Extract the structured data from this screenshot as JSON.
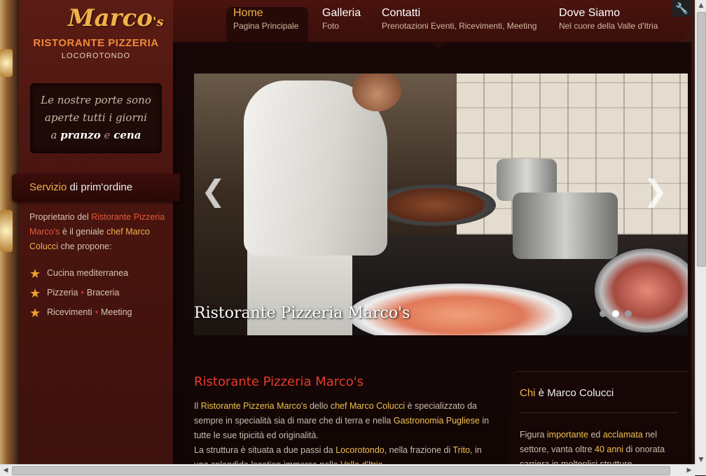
{
  "logo": {
    "script": "Marco",
    "script_suffix": "'s",
    "line2": "RISTORANTE PIZZERIA",
    "line3": "LOCOROTONDO"
  },
  "nav": [
    {
      "title": "Home",
      "subtitle": "Pagina Principale",
      "active": true
    },
    {
      "title": "Galleria",
      "subtitle": "Foto",
      "active": false
    },
    {
      "title": "Contatti",
      "subtitle": "Prenotazioni Eventi, Ricevimenti, Meeting",
      "active": false
    },
    {
      "title": "Dove Siamo",
      "subtitle": "Nel cuore della Valle d'Itria",
      "active": false
    }
  ],
  "hours": {
    "line1": "Le nostre porte sono",
    "line2": "aperte tutti i giorni",
    "a": "a",
    "pranzo": "pranzo",
    "e": "e",
    "cena": "cena"
  },
  "service": {
    "highlight": "Servizio",
    "rest": " di prim'ordine"
  },
  "intro": {
    "p1": "Proprietario del ",
    "p2": "Ristorante Pizzeria Marco's",
    "p3": " è il geniale ",
    "p4": "chef Marco Colucci",
    "p5": " che propone:"
  },
  "features": [
    {
      "a": "Cucina mediterranea",
      "b": ""
    },
    {
      "a": "Pizzeria",
      "b": "Braceria"
    },
    {
      "a": "Ricevimenti",
      "b": "Meeting"
    }
  ],
  "feature_separator": "•",
  "slider": {
    "caption": "Ristorante Pizzeria Marco's",
    "prev_arrow": "❮",
    "next_arrow": "❯",
    "slide_count": 3,
    "active_slide": 2
  },
  "article": {
    "title": "Ristorante Pizzeria Marco's",
    "s1": "Il ",
    "s2": "Ristorante Pizzeria Marco's",
    "s3": " dello ",
    "s4": "chef Marco Colucci",
    "s5": " è specializzato da sempre in specialità sia di mare che di terra e nella ",
    "s6": "Gastronomia Pugliese",
    "s7": " in tutte le sue tipicità ed originalità.",
    "s8": "La struttura è situata a due passi da ",
    "s9": "Locorotondo",
    "s10": ", nella frazione di ",
    "s11": "Trito",
    "s12": ", in una splendida location immersa nella ",
    "s13": "Valle d'Itria",
    "s14": "."
  },
  "aside": {
    "t1": "Chi",
    "t2": " è Marco Colucci",
    "p1": "Figura ",
    "p2": "importante",
    "p3": " ed ",
    "p4": "acclamata",
    "p5": " nel settore, vanta oltre ",
    "p6": "40 anni",
    "p7": " di onorata carriera in molteplici strutture"
  },
  "tool_icon": "🔧",
  "icons": {
    "star": "★"
  },
  "colors": {
    "accent": "#f0b24a",
    "red": "#e83a2c",
    "panel": "#4a1510"
  }
}
